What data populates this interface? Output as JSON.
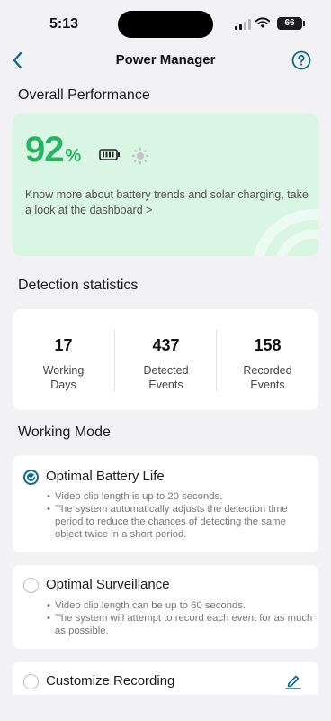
{
  "status_bar": {
    "time": "5:13",
    "battery_level": "66",
    "signal_bars_active": 2,
    "signal_bars_total": 4
  },
  "nav": {
    "title": "Power Manager",
    "back_icon": "chevron-left-icon",
    "help_icon": "question-circle-icon"
  },
  "performance": {
    "heading": "Overall Performance",
    "value": "92",
    "unit": "%",
    "description": "Know more about battery trends and solar charging, take a look at the dashboard >",
    "battery_icon": "battery-icon",
    "solar_icon": "sun-icon"
  },
  "detection": {
    "heading": "Detection statistics",
    "stats": [
      {
        "value": "17",
        "label": "Working Days"
      },
      {
        "value": "437",
        "label": "Detected Events"
      },
      {
        "value": "158",
        "label": "Recorded Events"
      }
    ]
  },
  "working_mode": {
    "heading": "Working Mode",
    "modes": [
      {
        "title": "Optimal Battery Life",
        "selected": true,
        "bullets": [
          "Video clip length is up to 20 seconds.",
          "The system automatically adjusts the detection time period to reduce the chances of detecting the same object twice in a short period."
        ]
      },
      {
        "title": "Optimal Surveillance",
        "selected": false,
        "bullets": [
          "Video clip length can be up to 60 seconds.",
          "The system will attempt to record each event for as much as possible."
        ]
      },
      {
        "title": "Customize Recording",
        "selected": false,
        "action_icon": "edit-icon"
      }
    ]
  },
  "colors": {
    "accent": "#0e6a8c",
    "performance_green": "#28b463",
    "performance_card_bg": "#d9f5e3",
    "page_bg": "#f2f2f4"
  }
}
